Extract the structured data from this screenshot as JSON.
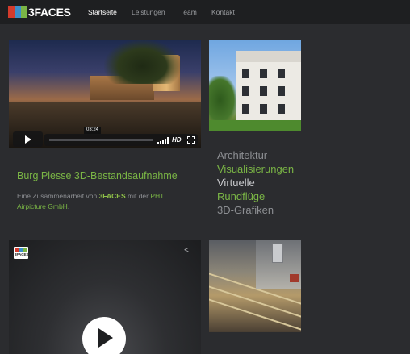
{
  "header": {
    "logo_text": "3FACES",
    "logo_colors": [
      "#d33b2c",
      "#3c8ec9",
      "#7ab545"
    ],
    "nav": [
      {
        "label": "Startseite",
        "active": true
      },
      {
        "label": "Leistungen",
        "active": false
      },
      {
        "label": "Team",
        "active": false
      },
      {
        "label": "Kontakt",
        "active": false
      }
    ]
  },
  "video1": {
    "timestamp": "03:24",
    "hd_label": "HD",
    "icons": [
      "play-icon",
      "volume-icon",
      "fullscreen-icon"
    ]
  },
  "project": {
    "title": "Burg Plesse 3D-Bestandsaufnahme",
    "desc_prefix": "Eine Zusammenarbeit von ",
    "desc_brand": "3FACES",
    "desc_mid": " mit der ",
    "desc_partner": "PHT Airpicture GmbH",
    "desc_suffix": "."
  },
  "services": [
    {
      "label": "Architektur-",
      "color": "#8c8e92"
    },
    {
      "label": "Visualisierungen",
      "color": "#7ab545"
    },
    {
      "label": "Virtuelle",
      "color": "#c8c9cc"
    },
    {
      "label": "Rundflüge",
      "color": "#7ab545"
    },
    {
      "label": "3D-Grafiken",
      "color": "#8c8e92"
    }
  ],
  "video2": {
    "mini_logo_text": "3FACES",
    "share_icon": "share-icon",
    "play_icon": "play-icon"
  },
  "accent_color": "#7ab545"
}
